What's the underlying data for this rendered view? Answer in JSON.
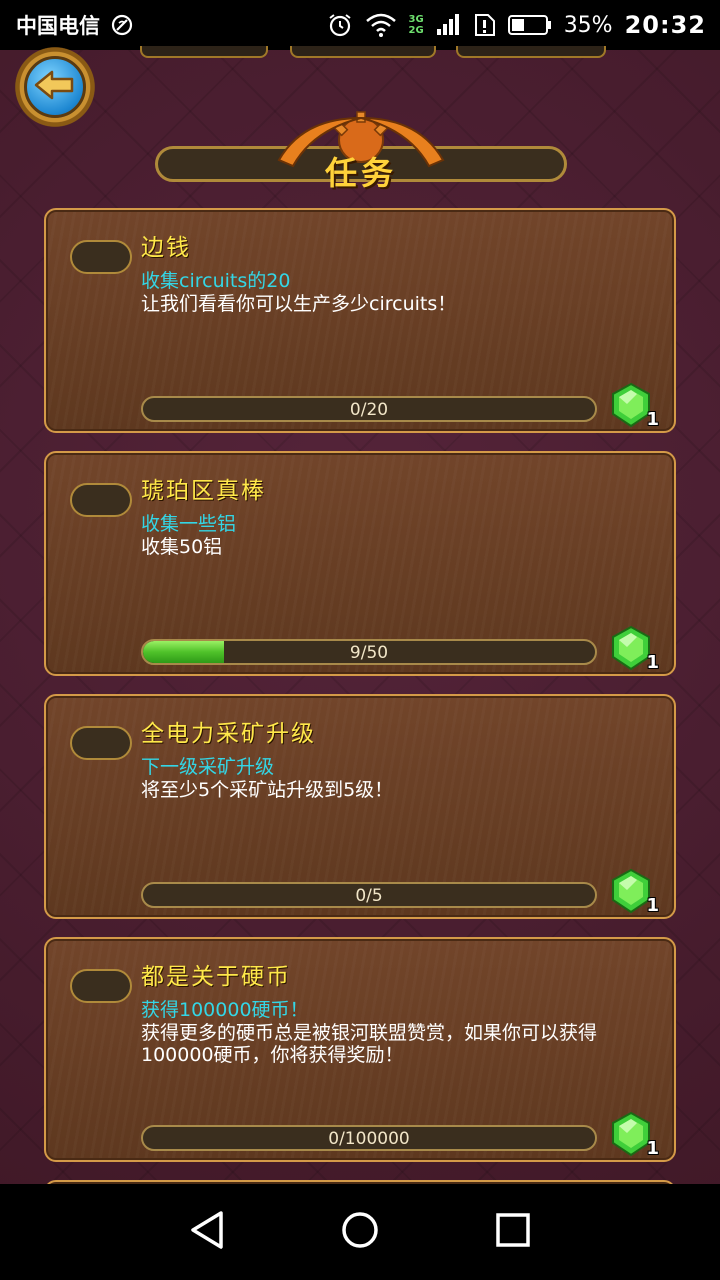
{
  "status_bar": {
    "carrier": "中国电信",
    "network_tags": [
      "3G",
      "2G"
    ],
    "battery_percent": "35%",
    "time": "20:32"
  },
  "screen": {
    "title": "任务"
  },
  "quests": [
    {
      "title": "边钱",
      "subtitle": "收集circuits的20",
      "description": "让我们看看你可以生产多少circuits！",
      "progress_label": "0/20",
      "progress_fraction": 0.0,
      "reward_count": "1"
    },
    {
      "title": "琥珀区真棒",
      "subtitle": "收集一些铝",
      "description": "收集50铝",
      "progress_label": "9/50",
      "progress_fraction": 0.18,
      "reward_count": "1"
    },
    {
      "title": "全电力采矿升级",
      "subtitle": "下一级采矿升级",
      "description": "将至少5个采矿站升级到5级！",
      "progress_label": "0/5",
      "progress_fraction": 0.0,
      "reward_count": "1"
    },
    {
      "title": "都是关于硬币",
      "subtitle": "获得100000硬币！",
      "description": "获得更多的硬币总是被银河联盟赞赏，如果你可以获得100000硬币，你将获得奖励！",
      "progress_label": "0/100000",
      "progress_fraction": 0.0,
      "reward_count": "1"
    }
  ],
  "icons": {
    "back": "back-arrow-icon",
    "reward": "green-gem-icon",
    "nav_back": "triangle-back-icon",
    "nav_home": "circle-home-icon",
    "nav_recent": "square-recent-icon"
  },
  "colors": {
    "background": "#4a1f2e",
    "card": "#6b4023",
    "title": "#ffd23a",
    "quest_title": "#ffe84a",
    "subtitle": "#33d6e6",
    "progress_fill": "#4fc22a"
  }
}
